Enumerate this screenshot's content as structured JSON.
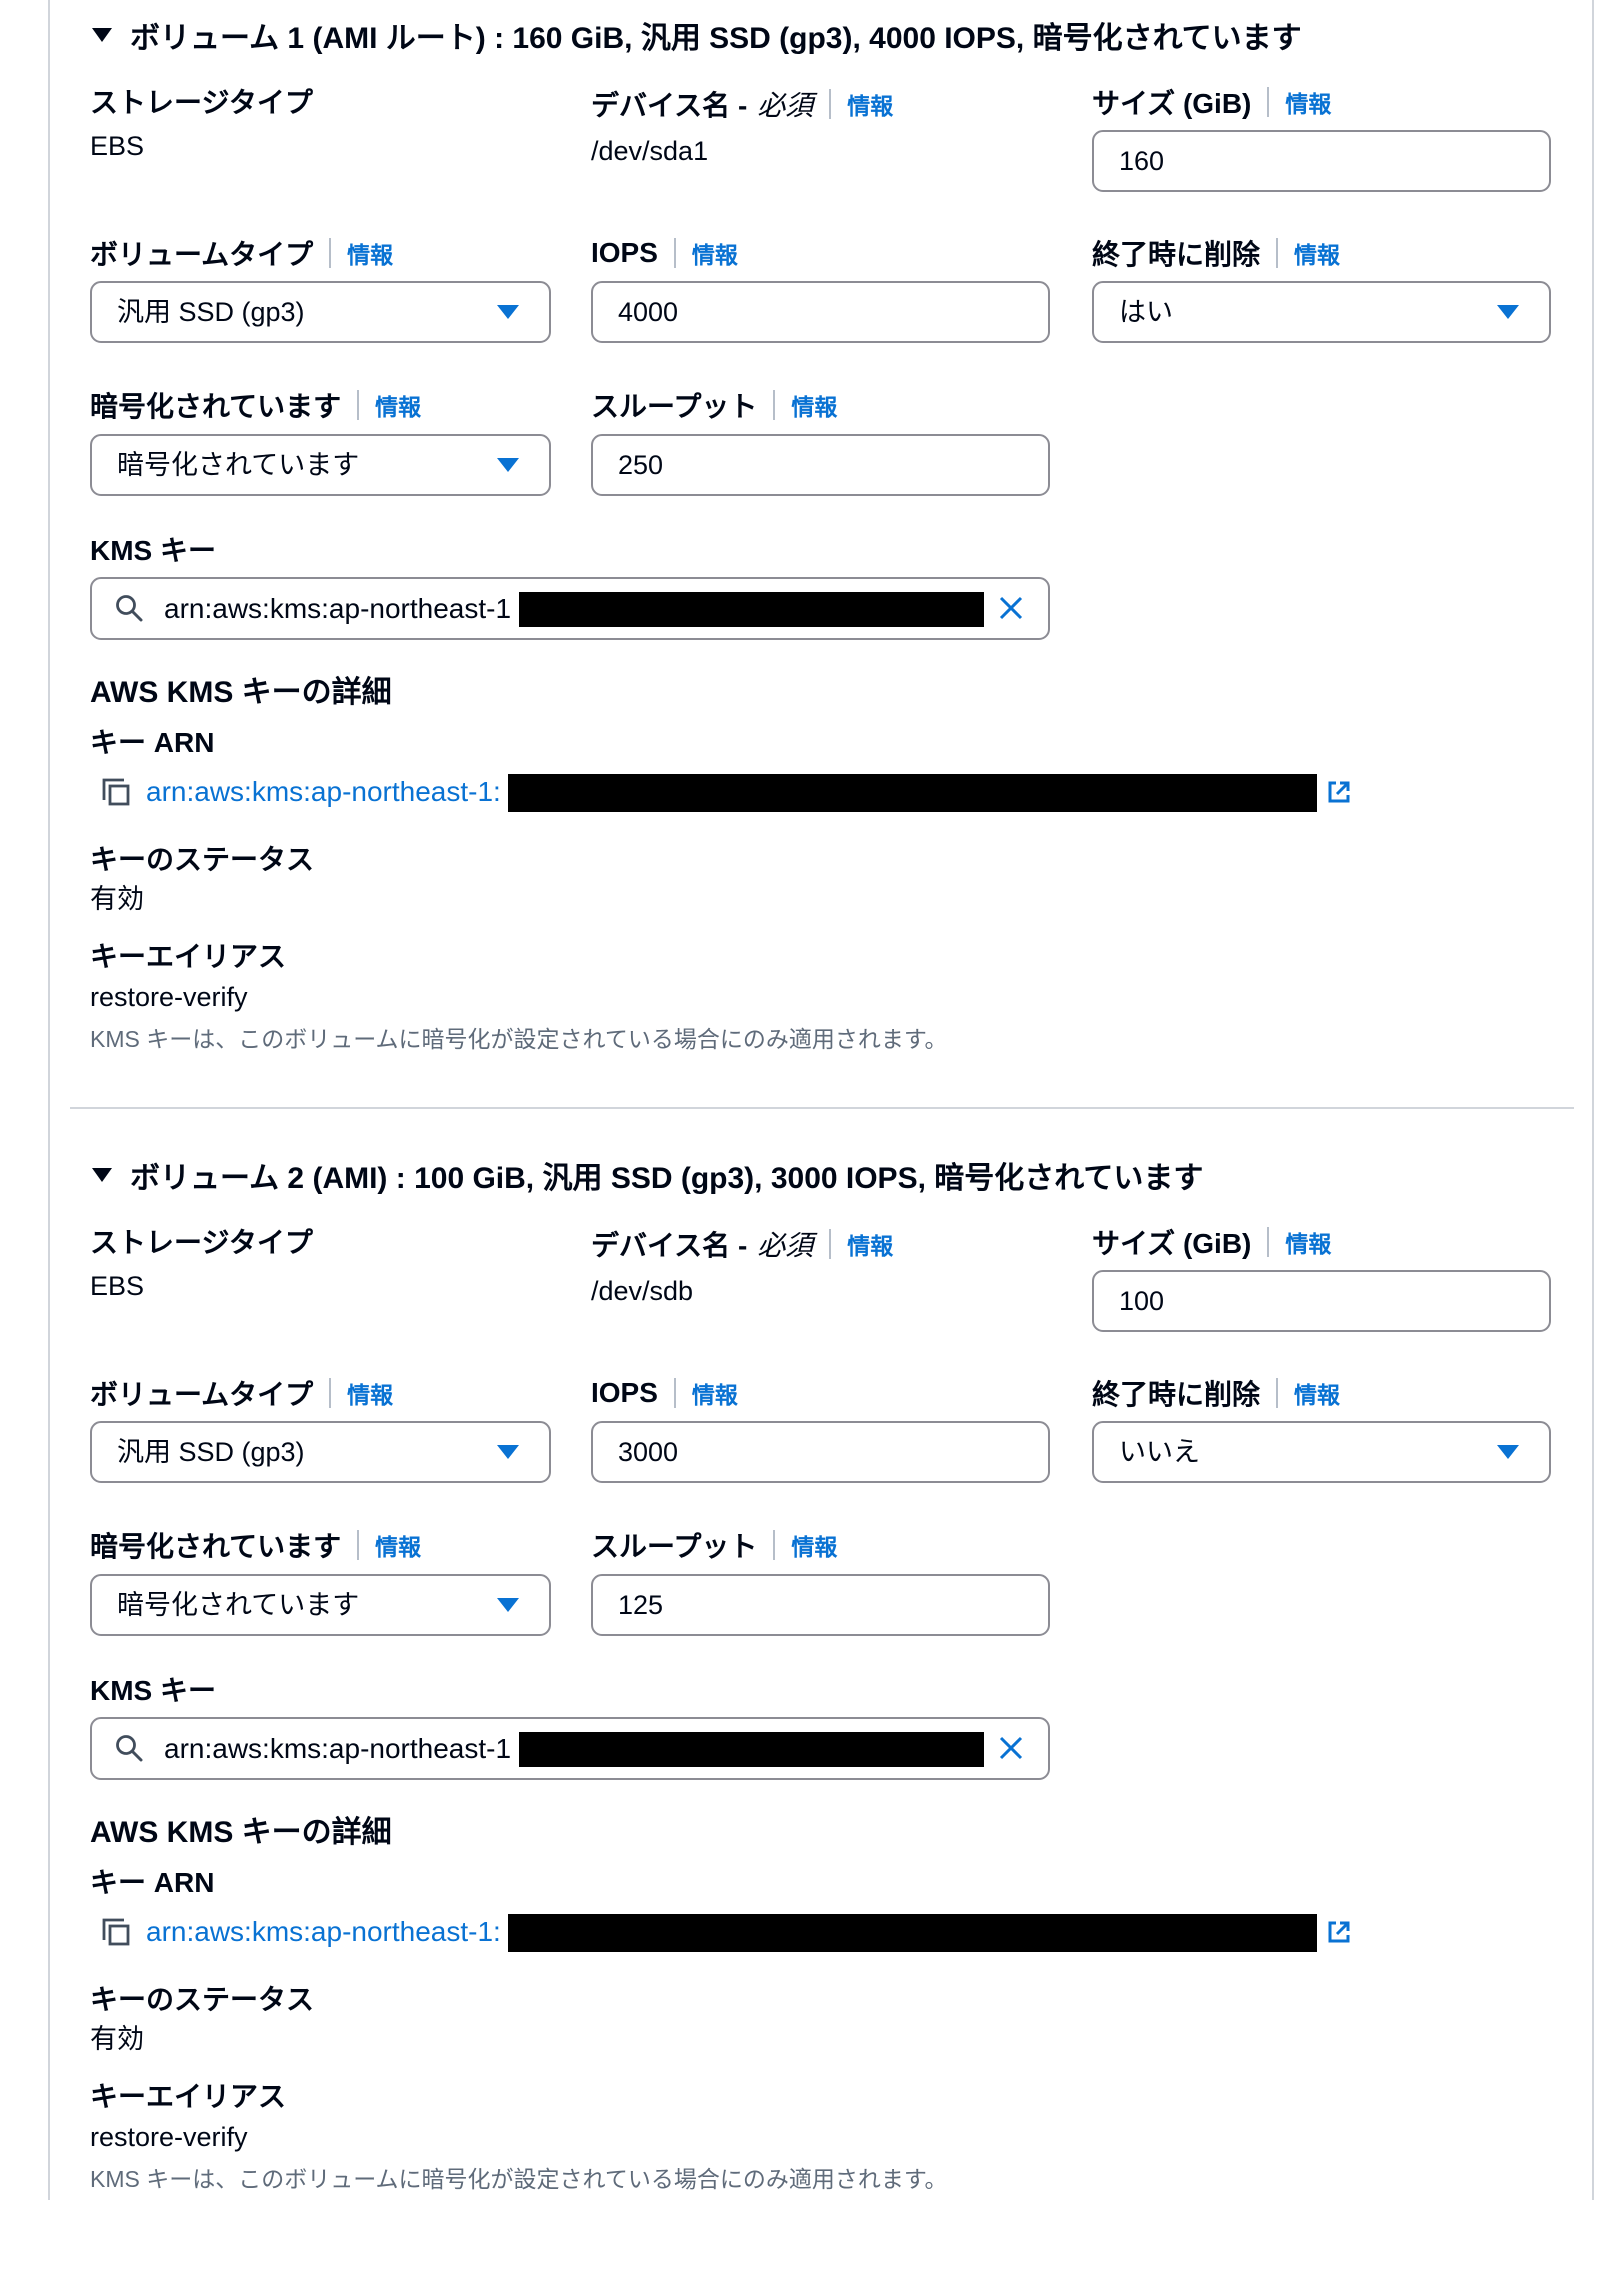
{
  "colors": {
    "text": "#000716",
    "link": "#0972d3",
    "input_border": "#8c8c94",
    "muted_text": "#5f6b7a",
    "rule": "#d1d5db",
    "redaction": "#000000"
  },
  "icons": {
    "section_toggle": "caret-down-icon",
    "dropdown": "caret-down-icon",
    "search": "search-icon",
    "clear": "close-icon",
    "copy": "copy-icon",
    "external_link": "external-link-icon"
  },
  "labels": {
    "storage_type": "ストレージタイプ",
    "device_name": "デバイス名 -",
    "required": "必須",
    "size": "サイズ (GiB)",
    "volume_type": "ボリュームタイプ",
    "iops": "IOPS",
    "delete_on_termination": "終了時に削除",
    "encrypted": "暗号化されています",
    "throughput": "スループット",
    "kms_key": "KMS キー",
    "kms_details_title": "AWS KMS キーの詳細",
    "key_arn": "キー ARN",
    "key_status": "キーのステータス",
    "key_alias": "キーエイリアス",
    "info": "情報"
  },
  "volumes": [
    {
      "header": "ボリューム 1 (AMI ルート) : 160 GiB, 汎用 SSD (gp3), 4000 IOPS, 暗号化されています",
      "storage_type": "EBS",
      "device_name": "/dev/sda1",
      "size": "160",
      "volume_type": "汎用 SSD (gp3)",
      "iops": "4000",
      "delete_on_termination": "はい",
      "encryption": "暗号化されています",
      "throughput": "250",
      "kms_key_input": "arn:aws:kms:ap-northeast-1",
      "key_arn_link": "arn:aws:kms:ap-northeast-1:",
      "key_status": "有効",
      "key_alias": "restore-verify",
      "kms_note": "KMS キーは、このボリュームに暗号化が設定されている場合にのみ適用されます。"
    },
    {
      "header": "ボリューム 2 (AMI) : 100 GiB, 汎用 SSD (gp3), 3000 IOPS, 暗号化されています",
      "storage_type": "EBS",
      "device_name": "/dev/sdb",
      "size": "100",
      "volume_type": "汎用 SSD (gp3)",
      "iops": "3000",
      "delete_on_termination": "いいえ",
      "encryption": "暗号化されています",
      "throughput": "125",
      "kms_key_input": "arn:aws:kms:ap-northeast-1",
      "key_arn_link": "arn:aws:kms:ap-northeast-1:",
      "key_status": "有効",
      "key_alias": "restore-verify",
      "kms_note": "KMS キーは、このボリュームに暗号化が設定されている場合にのみ適用されます。"
    }
  ]
}
